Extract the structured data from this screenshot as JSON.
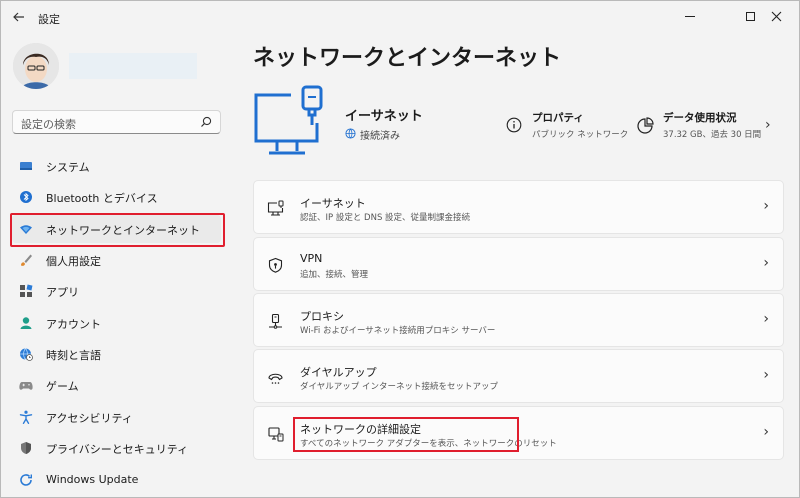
{
  "app": {
    "title": "設定",
    "back_icon": "back-arrow-icon"
  },
  "sidebar": {
    "search_placeholder": "設定の検索",
    "items": [
      {
        "label": "システム",
        "icon": "monitor-icon"
      },
      {
        "label": "Bluetooth とデバイス",
        "icon": "bluetooth-icon"
      },
      {
        "label": "ネットワークとインターネット",
        "icon": "wifi-diamond-icon",
        "selected": true
      },
      {
        "label": "個人用設定",
        "icon": "paint-brush-icon"
      },
      {
        "label": "アプリ",
        "icon": "apps-icon"
      },
      {
        "label": "アカウント",
        "icon": "account-icon"
      },
      {
        "label": "時刻と言語",
        "icon": "globe-clock-icon"
      },
      {
        "label": "ゲーム",
        "icon": "gamepad-icon"
      },
      {
        "label": "アクセシビリティ",
        "icon": "accessibility-icon"
      },
      {
        "label": "プライバシーとセキュリティ",
        "icon": "shield-icon"
      },
      {
        "label": "Windows Update",
        "icon": "update-icon"
      }
    ]
  },
  "main": {
    "title": "ネットワークとインターネット",
    "ethernet": {
      "name": "イーサネット",
      "status": "接続済み"
    },
    "properties": {
      "label": "プロパティ",
      "sub": "パブリック ネットワーク"
    },
    "data_usage": {
      "label": "データ使用状況",
      "sub": "37.32 GB、過去 30 日間"
    },
    "cards": [
      {
        "title": "イーサネット",
        "sub": "認証、IP 設定と DNS 設定、従量制課金接続",
        "icon": "ethernet-monitor-icon"
      },
      {
        "title": "VPN",
        "sub": "追加、接続、管理",
        "icon": "vpn-shield-icon"
      },
      {
        "title": "プロキシ",
        "sub": "Wi-Fi およびイーサネット接続用プロキシ サーバー",
        "icon": "proxy-icon"
      },
      {
        "title": "ダイヤルアップ",
        "sub": "ダイヤルアップ インターネット接続をセットアップ",
        "icon": "dialup-icon"
      },
      {
        "title": "ネットワークの詳細設定",
        "sub": "すべてのネットワーク アダプターを表示、ネットワークのリセット",
        "icon": "network-pc-icon"
      }
    ]
  },
  "colors": {
    "accent": "#0067c0",
    "highlight": "#e01e2e",
    "background": "#f3f3f3",
    "card": "#fbfbfb"
  }
}
